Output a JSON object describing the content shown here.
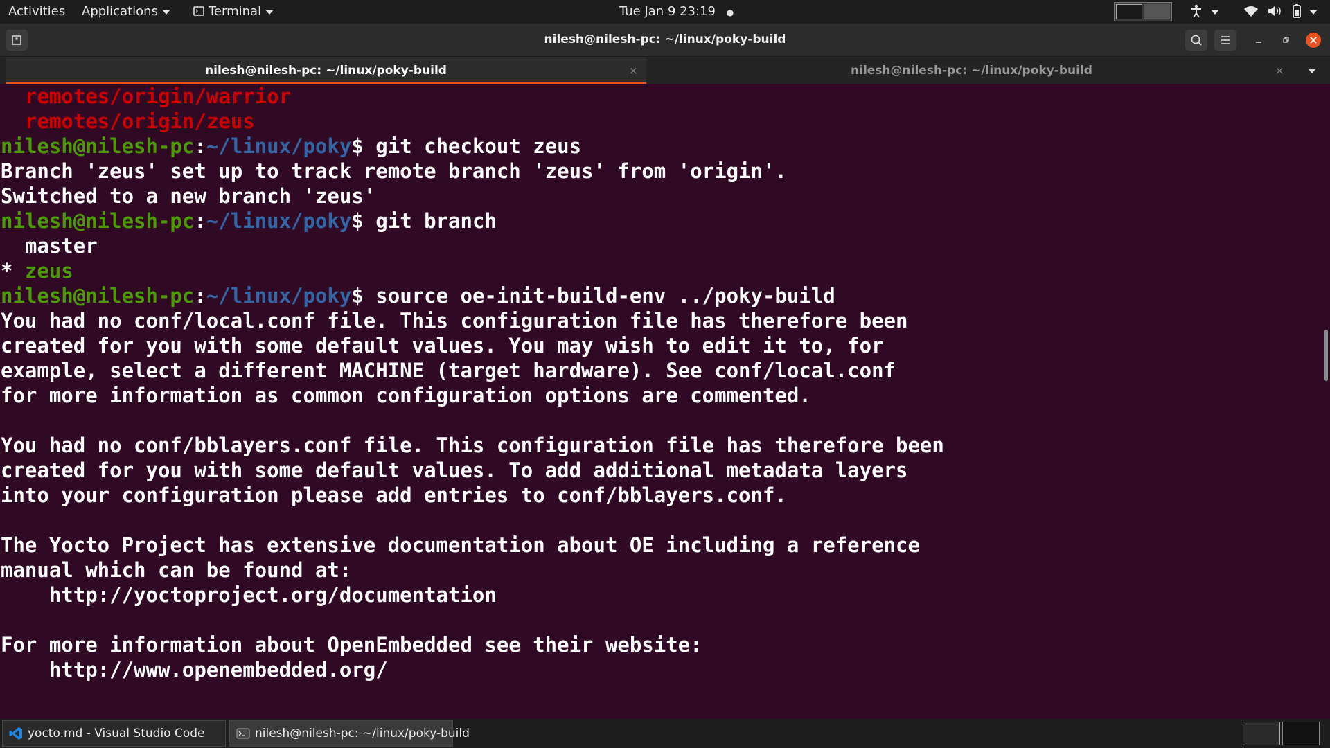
{
  "top_panel": {
    "activities": "Activities",
    "applications": "Applications",
    "terminal_menu": "Terminal",
    "clock": "Tue Jan 9  23:19",
    "clock_dot": "●"
  },
  "window": {
    "title": "nilesh@nilesh-pc: ~/linux/poky-build"
  },
  "tabs": [
    {
      "label": "nilesh@nilesh-pc: ~/linux/poky-build",
      "active": true,
      "close": "×"
    },
    {
      "label": "nilesh@nilesh-pc: ~/linux/poky-build",
      "active": false,
      "close": "×"
    }
  ],
  "terminal": {
    "prompt_user": "nilesh@nilesh-pc",
    "prompt_colon": ":",
    "prompt_path": "~/linux/poky",
    "prompt_dollar": "$",
    "lines": {
      "l1": "  remotes/origin/warrior",
      "l2": "  remotes/origin/zeus",
      "l3_cmd": " git checkout zeus",
      "l4": "Branch 'zeus' set up to track remote branch 'zeus' from 'origin'.",
      "l5": "Switched to a new branch 'zeus'",
      "l6_cmd": " git branch",
      "l7": "  master",
      "l8_star": "* ",
      "l8_branch": "zeus",
      "l9_cmd": " source oe-init-build-env ../poky-build",
      "l10": "You had no conf/local.conf file. This configuration file has therefore been",
      "l11": "created for you with some default values. You may wish to edit it to, for",
      "l12": "example, select a different MACHINE (target hardware). See conf/local.conf",
      "l13": "for more information as common configuration options are commented.",
      "l15": "You had no conf/bblayers.conf file. This configuration file has therefore been",
      "l16": "created for you with some default values. To add additional metadata layers",
      "l17": "into your configuration please add entries to conf/bblayers.conf.",
      "l19": "The Yocto Project has extensive documentation about OE including a reference",
      "l20": "manual which can be found at:",
      "l21": "    http://yoctoproject.org/documentation",
      "l23": "For more information about OpenEmbedded see their website:",
      "l24": "    http://www.openembedded.org/"
    }
  },
  "taskbar": {
    "items": [
      {
        "label": "yocto.md - Visual Studio Code",
        "icon": "vscode-icon"
      },
      {
        "label": "nilesh@nilesh-pc: ~/linux/poky-build",
        "icon": "terminal-icon"
      }
    ]
  },
  "colors": {
    "terminal_bg": "#300a24",
    "prompt_user": "#4e9a06",
    "prompt_path": "#3465a4",
    "branch_remote": "#cc0000",
    "active_tab_underline": "#e95420",
    "close_button": "#e95420"
  }
}
